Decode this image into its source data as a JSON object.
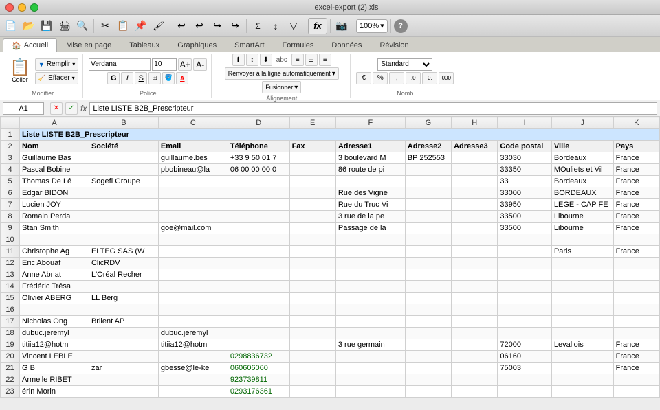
{
  "titlebar": {
    "title": "excel-export (2).xls",
    "file_icon": "📄"
  },
  "toolbar1": {
    "zoom_value": "100%"
  },
  "ribbon": {
    "tabs": [
      {
        "label": "Accueil",
        "icon": "🏠",
        "active": true
      },
      {
        "label": "Mise en page"
      },
      {
        "label": "Tableaux"
      },
      {
        "label": "Graphiques"
      },
      {
        "label": "SmartArt"
      },
      {
        "label": "Formules"
      },
      {
        "label": "Données"
      },
      {
        "label": "Révision"
      }
    ],
    "groups": {
      "modifier": {
        "label": "Modifier",
        "coller": "Coller",
        "remplir": "Remplir",
        "effacer": "Effacer"
      },
      "police": {
        "label": "Police",
        "font_name": "Verdana",
        "font_size": "10"
      },
      "alignement": {
        "label": "Alignement",
        "abc": "abc",
        "wrap_text": "Renvoyer à la ligne automatiquement",
        "fusionner": "Fusionner"
      },
      "nombre": {
        "label": "Nomb",
        "format": "Standard"
      }
    }
  },
  "formula_bar": {
    "cell_ref": "A1",
    "formula": "Liste LISTE B2B_Prescripteur",
    "fx_label": "fx"
  },
  "spreadsheet": {
    "col_headers": [
      "",
      "A",
      "B",
      "C",
      "D",
      "E",
      "F",
      "G",
      "H",
      "I",
      "J",
      "K"
    ],
    "rows": [
      {
        "num": "1",
        "cells": [
          "Liste LISTE B2B_Prescripteur",
          "",
          "",
          "",
          "",
          "",
          "",
          "",
          "",
          "",
          ""
        ]
      },
      {
        "num": "2",
        "cells": [
          "Nom",
          "Société",
          "Email",
          "Téléphone",
          "Fax",
          "Adresse1",
          "Adresse2",
          "Adresse3",
          "Code postal",
          "Ville",
          "Pays"
        ]
      },
      {
        "num": "3",
        "cells": [
          "Guillaume Bas",
          "",
          "guillaume.bes",
          "+33 9 50 01 7",
          "",
          "3 boulevard M",
          "BP 252553",
          "",
          "33030",
          "Bordeaux",
          "France"
        ]
      },
      {
        "num": "4",
        "cells": [
          "Pascal Bobine",
          "",
          "pbobineau@la",
          "06 00 00 00 0",
          "",
          "86 route de pi",
          "",
          "",
          "33350",
          "MOuliets et Vil",
          "France"
        ]
      },
      {
        "num": "5",
        "cells": [
          "Thomas De Lé",
          "Sogefi Groupe",
          "",
          "",
          "",
          "",
          "",
          "",
          "33",
          "Bordeaux",
          "France"
        ]
      },
      {
        "num": "6",
        "cells": [
          "Edgar BIDON",
          "",
          "",
          "",
          "",
          "Rue des Vigne",
          "",
          "",
          "33000",
          "BORDEAUX",
          "France"
        ]
      },
      {
        "num": "7",
        "cells": [
          "Lucien JOY",
          "",
          "",
          "",
          "",
          "Rue du Truc Vi",
          "",
          "",
          "33950",
          "LEGE - CAP FE",
          "France"
        ]
      },
      {
        "num": "8",
        "cells": [
          "Romain Perda",
          "",
          "",
          "",
          "",
          "3 rue de la pe",
          "",
          "",
          "33500",
          "Libourne",
          "France"
        ]
      },
      {
        "num": "9",
        "cells": [
          "Stan Smith",
          "",
          "goe@mail.com",
          "",
          "",
          "Passage de la",
          "",
          "",
          "33500",
          "Libourne",
          "France"
        ]
      },
      {
        "num": "10",
        "cells": [
          "",
          "",
          "",
          "",
          "",
          "",
          "",
          "",
          "",
          "",
          ""
        ]
      },
      {
        "num": "11",
        "cells": [
          "Christophe Ag",
          "ELTEG SAS (W",
          "",
          "",
          "",
          "",
          "",
          "",
          "",
          "Paris",
          "France"
        ]
      },
      {
        "num": "12",
        "cells": [
          "Eric Abouaf",
          "ClicRDV",
          "",
          "",
          "",
          "",
          "",
          "",
          "",
          "",
          ""
        ]
      },
      {
        "num": "13",
        "cells": [
          "Anne Abriat",
          "L'Oréal Recher",
          "",
          "",
          "",
          "",
          "",
          "",
          "",
          "",
          ""
        ]
      },
      {
        "num": "14",
        "cells": [
          "Frédéric Trésa",
          "",
          "",
          "",
          "",
          "",
          "",
          "",
          "",
          "",
          ""
        ]
      },
      {
        "num": "15",
        "cells": [
          "Olivier ABERG",
          "LL Berg",
          "",
          "",
          "",
          "",
          "",
          "",
          "",
          "",
          ""
        ]
      },
      {
        "num": "16",
        "cells": [
          "",
          "",
          "",
          "",
          "",
          "",
          "",
          "",
          "",
          "",
          ""
        ]
      },
      {
        "num": "17",
        "cells": [
          "Nicholas Ong",
          "Brilent AP",
          "",
          "",
          "",
          "",
          "",
          "",
          "",
          "",
          ""
        ]
      },
      {
        "num": "18",
        "cells": [
          "dubuc.jeremyl",
          "",
          "dubuc.jeremyl",
          "",
          "",
          "",
          "",
          "",
          "",
          "",
          ""
        ]
      },
      {
        "num": "19",
        "cells": [
          "titiia12@hotm",
          "",
          "titiia12@hotm",
          "",
          "",
          "3 rue germain",
          "",
          "",
          "72000",
          "Levallois",
          "France"
        ]
      },
      {
        "num": "20",
        "cells": [
          "Vincent LEBLE",
          "",
          "",
          "0298836732",
          "",
          "",
          "",
          "",
          "06160",
          "",
          "France"
        ]
      },
      {
        "num": "21",
        "cells": [
          "G B",
          "zar",
          "gbesse@le-ke",
          "060606060",
          "",
          "",
          "",
          "",
          "75003",
          "",
          "France"
        ]
      },
      {
        "num": "22",
        "cells": [
          "Armelle RIBET",
          "",
          "",
          "923739811",
          "",
          "",
          "",
          "",
          "",
          "",
          ""
        ]
      },
      {
        "num": "23",
        "cells": [
          "érin Morin",
          "",
          "",
          "0293176361",
          "",
          "",
          "",
          "",
          "",
          "",
          ""
        ]
      }
    ]
  }
}
